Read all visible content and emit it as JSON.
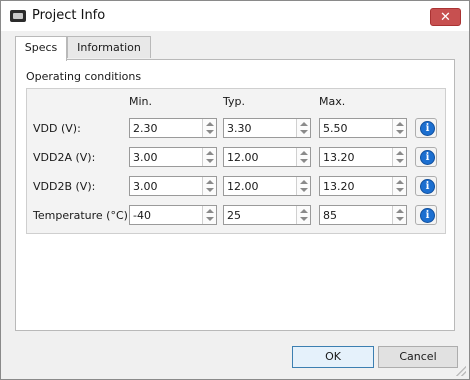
{
  "window": {
    "title": "Project Info",
    "close_label": "✕"
  },
  "tabs": [
    {
      "label": "Specs",
      "active": true
    },
    {
      "label": "Information",
      "active": false
    }
  ],
  "specs": {
    "group_title": "Operating conditions",
    "columns": [
      "Min.",
      "Typ.",
      "Max."
    ],
    "rows": [
      {
        "label": "VDD (V):",
        "min": "2.30",
        "typ": "3.30",
        "max": "5.50",
        "info_icon": "info-icon"
      },
      {
        "label": "VDD2A (V):",
        "min": "3.00",
        "typ": "12.00",
        "max": "13.20",
        "info_icon": "info-icon"
      },
      {
        "label": "VDD2B (V):",
        "min": "3.00",
        "typ": "12.00",
        "max": "13.20",
        "info_icon": "info-icon"
      },
      {
        "label": "Temperature (°C):",
        "min": "-40",
        "typ": "25",
        "max": "85",
        "info_icon": "info-icon"
      }
    ]
  },
  "footer": {
    "ok_label": "OK",
    "cancel_label": "Cancel"
  },
  "colors": {
    "info_blue": "#1c6fd0",
    "close_red": "#c75050"
  }
}
